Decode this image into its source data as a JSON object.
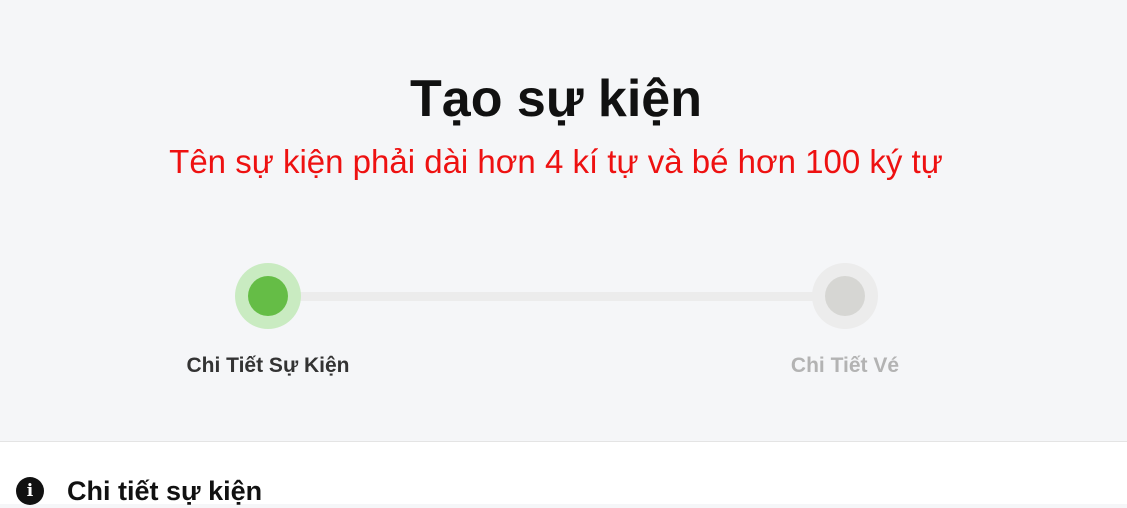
{
  "page": {
    "title": "Tạo sự kiện",
    "error_message": "Tên sự kiện phải dài hơn 4 kí tự và bé hơn 100 ký tự"
  },
  "stepper": {
    "steps": [
      {
        "label": "Chi Tiết Sự Kiện",
        "state": "active"
      },
      {
        "label": "Chi Tiết Vé",
        "state": "inactive"
      }
    ],
    "colors": {
      "active": "#65bd46",
      "inactive": "#d6d6d3"
    }
  },
  "section": {
    "icon": "info-circle-icon",
    "icon_glyph": "i",
    "title": "Chi tiết sự kiện"
  }
}
